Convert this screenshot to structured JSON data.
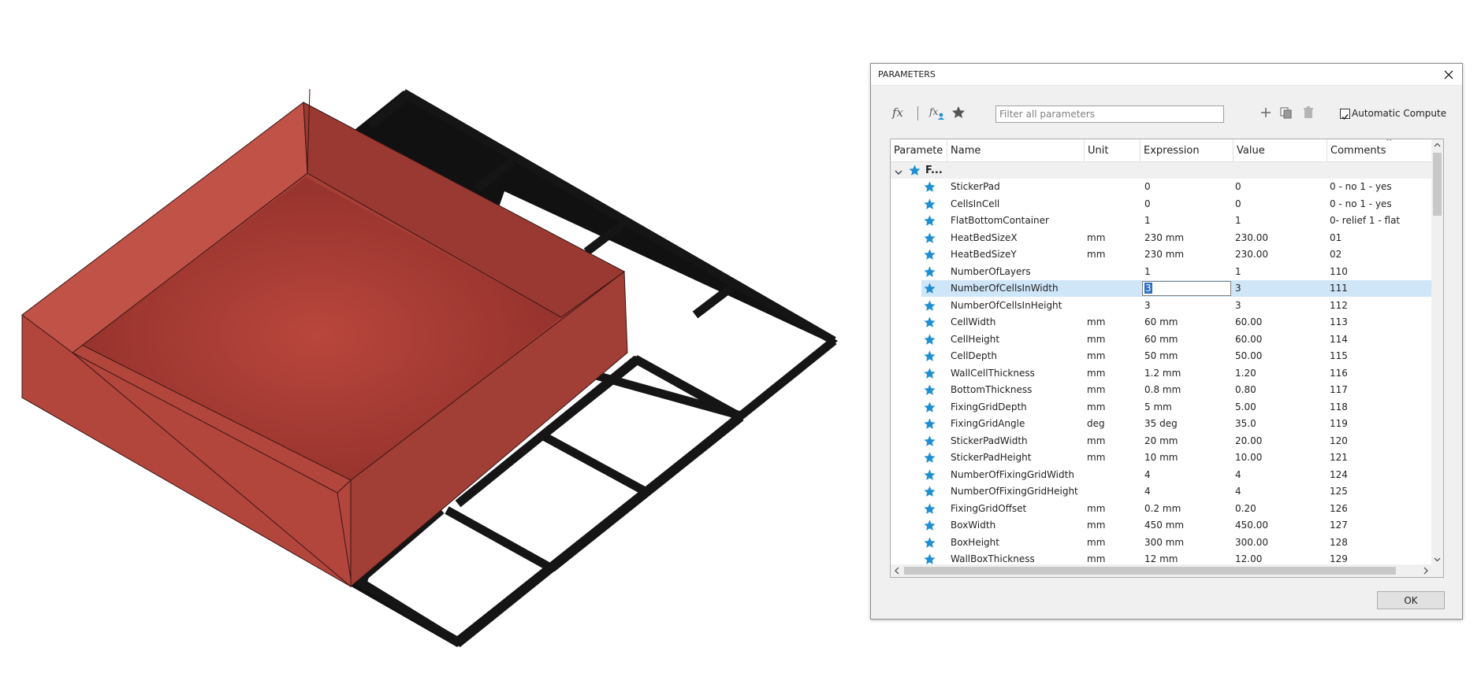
{
  "dialog": {
    "title": "PARAMETERS",
    "filter_placeholder": "Filter all parameters",
    "auto_compute_label": "Automatic Compute",
    "auto_compute_checked": true,
    "ok_label": "OK"
  },
  "table": {
    "headers": {
      "parameter": "Paramete",
      "name": "Name",
      "unit": "Unit",
      "expression": "Expression",
      "value": "Value",
      "comments": "Comments"
    },
    "group_label": "F...",
    "selected_row": 6,
    "editing_expression": "3",
    "rows": [
      {
        "name": "StickerPad",
        "unit": "",
        "expression": "0",
        "value": "0",
        "comment": "0 - no 1 - yes"
      },
      {
        "name": "CellsInCell",
        "unit": "",
        "expression": "0",
        "value": "0",
        "comment": "0 - no 1 - yes"
      },
      {
        "name": "FlatBottomContainer",
        "unit": "",
        "expression": "1",
        "value": "1",
        "comment": "0- relief 1 - flat"
      },
      {
        "name": "HeatBedSizeX",
        "unit": "mm",
        "expression": "230 mm",
        "value": "230.00",
        "comment": "01"
      },
      {
        "name": "HeatBedSizeY",
        "unit": "mm",
        "expression": "230 mm",
        "value": "230.00",
        "comment": "02"
      },
      {
        "name": "NumberOfLayers",
        "unit": "",
        "expression": "1",
        "value": "1",
        "comment": "110"
      },
      {
        "name": "NumberOfCellsInWidth",
        "unit": "",
        "expression": "3",
        "value": "3",
        "comment": "111"
      },
      {
        "name": "NumberOfCellsInHeight",
        "unit": "",
        "expression": "3",
        "value": "3",
        "comment": "112"
      },
      {
        "name": "CellWidth",
        "unit": "mm",
        "expression": "60 mm",
        "value": "60.00",
        "comment": "113"
      },
      {
        "name": "CellHeight",
        "unit": "mm",
        "expression": "60 mm",
        "value": "60.00",
        "comment": "114"
      },
      {
        "name": "CellDepth",
        "unit": "mm",
        "expression": "50 mm",
        "value": "50.00",
        "comment": "115"
      },
      {
        "name": "WallCellThickness",
        "unit": "mm",
        "expression": "1.2 mm",
        "value": "1.20",
        "comment": "116"
      },
      {
        "name": "BottomThickness",
        "unit": "mm",
        "expression": "0.8 mm",
        "value": "0.80",
        "comment": "117"
      },
      {
        "name": "FixingGridDepth",
        "unit": "mm",
        "expression": "5 mm",
        "value": "5.00",
        "comment": "118"
      },
      {
        "name": "FixingGridAngle",
        "unit": "deg",
        "expression": "35 deg",
        "value": "35.0",
        "comment": "119"
      },
      {
        "name": "StickerPadWidth",
        "unit": "mm",
        "expression": "20 mm",
        "value": "20.00",
        "comment": "120"
      },
      {
        "name": "StickerPadHeight",
        "unit": "mm",
        "expression": "10 mm",
        "value": "10.00",
        "comment": "121"
      },
      {
        "name": "NumberOfFixingGridWidth",
        "unit": "",
        "expression": "4",
        "value": "4",
        "comment": "124"
      },
      {
        "name": "NumberOfFixingGridHeight",
        "unit": "",
        "expression": "4",
        "value": "4",
        "comment": "125"
      },
      {
        "name": "FixingGridOffset",
        "unit": "mm",
        "expression": "0.2 mm",
        "value": "0.20",
        "comment": "126"
      },
      {
        "name": "BoxWidth",
        "unit": "mm",
        "expression": "450 mm",
        "value": "450.00",
        "comment": "127"
      },
      {
        "name": "BoxHeight",
        "unit": "mm",
        "expression": "300 mm",
        "value": "300.00",
        "comment": "128"
      },
      {
        "name": "WallBoxThickness",
        "unit": "mm",
        "expression": "12 mm",
        "value": "12.00",
        "comment": "129"
      }
    ]
  },
  "icons": {
    "fx": "function-icon",
    "fx_user": "user-parameter-function-icon",
    "favorites": "star-icon",
    "add": "plus-icon",
    "copy": "copy-icon",
    "delete": "trash-icon",
    "close": "close-icon"
  },
  "colors": {
    "star": "#1e8fd1",
    "selection": "#cfe5f8",
    "box_fill": "#b0453d",
    "grid_frame": "#1a1a1a"
  }
}
